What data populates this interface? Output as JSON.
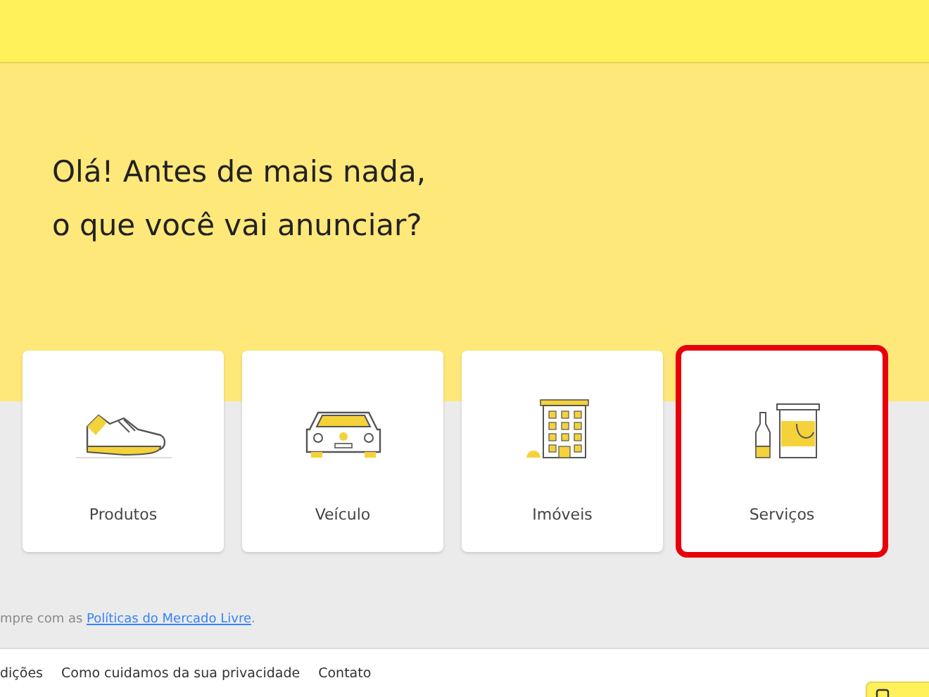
{
  "heading": [
    "Olá! Antes de mais nada,",
    "o que você vai anunciar?"
  ],
  "categories": [
    {
      "kind": "shoe",
      "label": "Produtos",
      "highlighted": false
    },
    {
      "kind": "car",
      "label": "Veículo",
      "highlighted": false
    },
    {
      "kind": "building",
      "label": "Imóveis",
      "highlighted": false
    },
    {
      "kind": "paint",
      "label": "Serviços",
      "highlighted": true
    }
  ],
  "notice": {
    "text": "mpre com as",
    "link": "Políticas do Mercado Livre",
    "end": "."
  },
  "footer_links": [
    "dições",
    "Como cuidamos da sua privacidade",
    "Contato"
  ],
  "feedback_button": true
}
